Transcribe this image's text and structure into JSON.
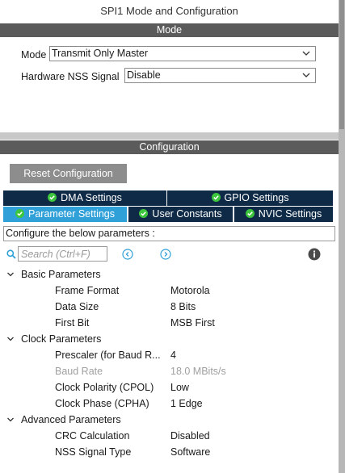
{
  "panel": {
    "title": "SPI1 Mode and Configuration"
  },
  "mode_section": {
    "header": "Mode",
    "mode_label": "Mode",
    "mode_value": "Transmit Only Master",
    "nss_label": "Hardware NSS Signal",
    "nss_value": "Disable"
  },
  "config_section": {
    "header": "Configuration",
    "reset_label": "Reset Configuration",
    "tabs_row1": [
      {
        "label": "DMA Settings"
      },
      {
        "label": "GPIO Settings"
      }
    ],
    "tabs_row2": [
      {
        "label": "Parameter Settings",
        "active": true
      },
      {
        "label": "User Constants"
      },
      {
        "label": "NVIC Settings"
      }
    ],
    "description": "Configure the below parameters :",
    "search_placeholder": "Search (Ctrl+F)"
  },
  "parameters": {
    "groups": [
      {
        "name": "Basic Parameters",
        "items": [
          {
            "name": "Frame Format",
            "value": "Motorola"
          },
          {
            "name": "Data Size",
            "value": "8 Bits"
          },
          {
            "name": "First Bit",
            "value": "MSB First"
          }
        ]
      },
      {
        "name": "Clock Parameters",
        "items": [
          {
            "name": "Prescaler (for Baud R...",
            "value": "4"
          },
          {
            "name": "Baud Rate",
            "value": "18.0 MBits/s",
            "disabled": true
          },
          {
            "name": "Clock Polarity (CPOL)",
            "value": "Low"
          },
          {
            "name": "Clock Phase (CPHA)",
            "value": "1 Edge"
          }
        ]
      },
      {
        "name": "Advanced Parameters",
        "items": [
          {
            "name": "CRC Calculation",
            "value": "Disabled"
          },
          {
            "name": "NSS Signal Type",
            "value": "Software"
          }
        ]
      }
    ]
  },
  "colors": {
    "section_header": "#5b5b5b",
    "tab_dark": "#0e2a47",
    "tab_active": "#2fa0d8",
    "reset_button": "#8d8d8d",
    "nav_icon": "#2fa0d8"
  },
  "icons": {
    "tab_check": "check-circle-icon",
    "search": "search-icon",
    "prev": "previous-circle-icon",
    "next": "next-circle-icon",
    "info": "info-icon",
    "expand": "chevron-down-icon",
    "dropdown": "chevron-down-icon"
  }
}
